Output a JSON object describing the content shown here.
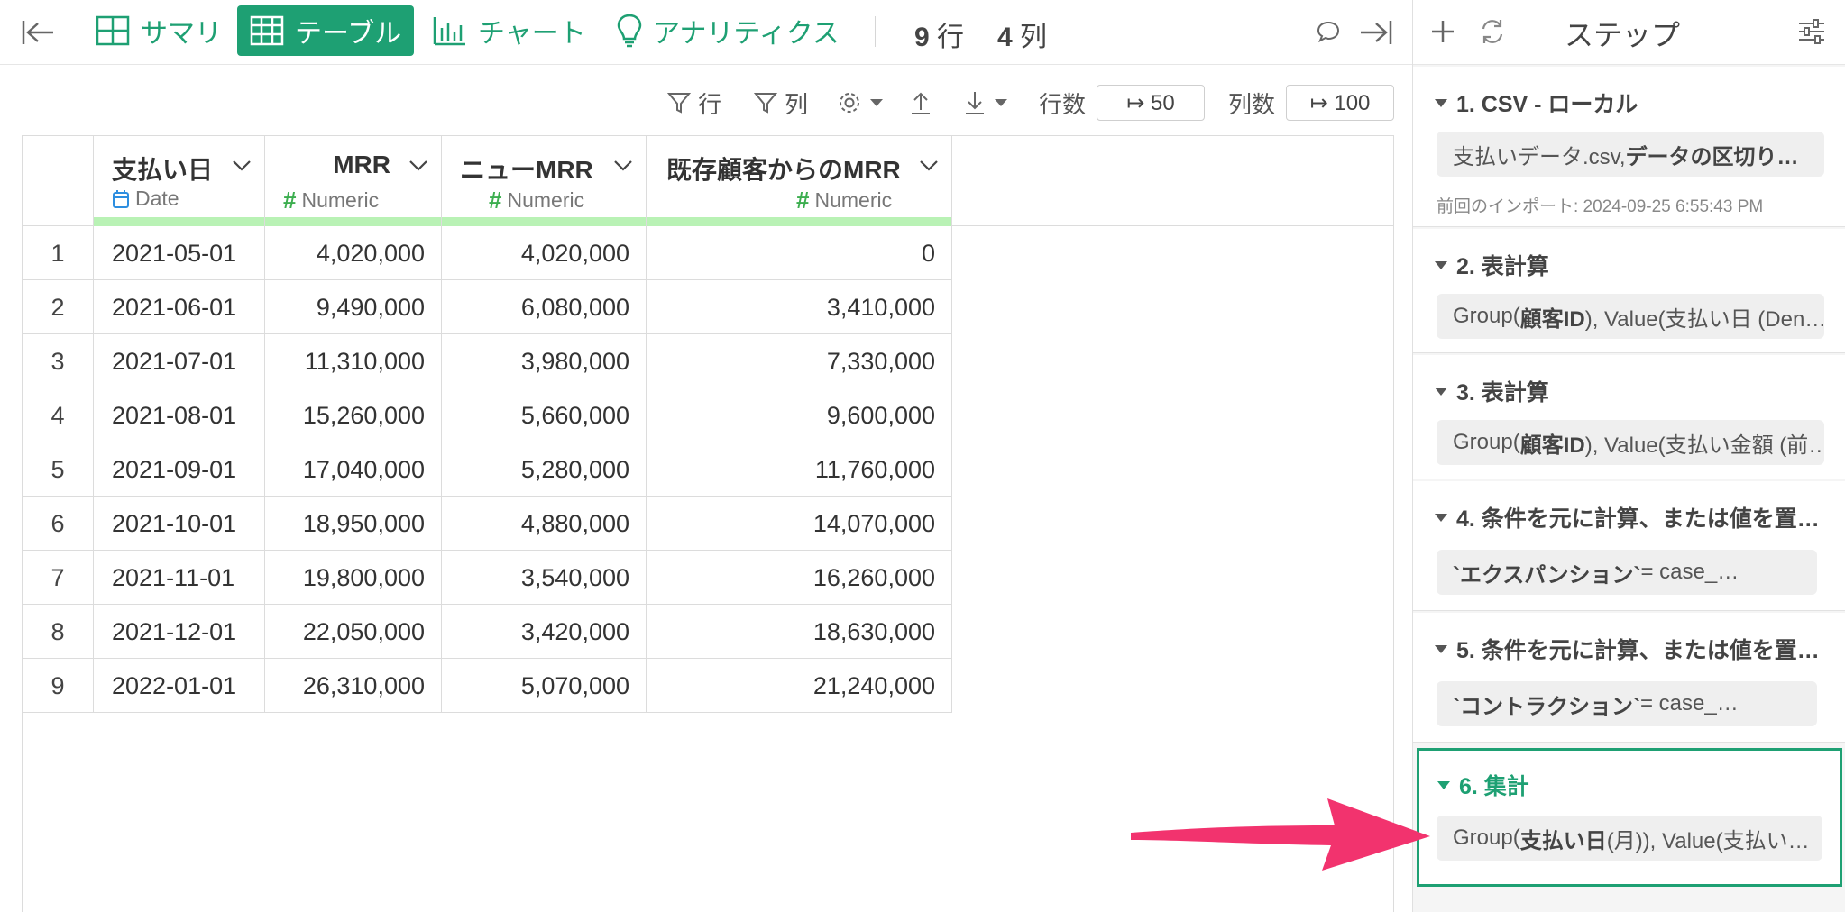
{
  "toolbar": {
    "tabs": [
      {
        "label": "サマリ",
        "icon": "summary-grid-icon",
        "active": false
      },
      {
        "label": "テーブル",
        "icon": "table-icon",
        "active": true
      },
      {
        "label": "チャート",
        "icon": "bar-chart-icon",
        "active": false
      },
      {
        "label": "アナリティクス",
        "icon": "lightbulb-icon",
        "active": false
      }
    ],
    "rows_count": "9",
    "rows_unit": "行",
    "cols_count": "4",
    "cols_unit": "列"
  },
  "subtoolbar": {
    "filter_rows": "行",
    "filter_cols": "列",
    "rows_label": "行数",
    "rows_value": "↦ 50",
    "cols_label": "列数",
    "cols_value": "↦ 100"
  },
  "table": {
    "columns": [
      {
        "name": "支払い日",
        "type": "Date"
      },
      {
        "name": "MRR",
        "type": "Numeric"
      },
      {
        "name": "ニューMRR",
        "type": "Numeric"
      },
      {
        "name": "既存顧客からのMRR",
        "type": "Numeric"
      }
    ],
    "rows": [
      [
        "1",
        "2021-05-01",
        "4,020,000",
        "4,020,000",
        "0"
      ],
      [
        "2",
        "2021-06-01",
        "9,490,000",
        "6,080,000",
        "3,410,000"
      ],
      [
        "3",
        "2021-07-01",
        "11,310,000",
        "3,980,000",
        "7,330,000"
      ],
      [
        "4",
        "2021-08-01",
        "15,260,000",
        "5,660,000",
        "9,600,000"
      ],
      [
        "5",
        "2021-09-01",
        "17,040,000",
        "5,280,000",
        "11,760,000"
      ],
      [
        "6",
        "2021-10-01",
        "18,950,000",
        "4,880,000",
        "14,070,000"
      ],
      [
        "7",
        "2021-11-01",
        "19,800,000",
        "3,540,000",
        "16,260,000"
      ],
      [
        "8",
        "2021-12-01",
        "22,050,000",
        "3,420,000",
        "18,630,000"
      ],
      [
        "9",
        "2022-01-01",
        "26,310,000",
        "5,070,000",
        "21,240,000"
      ]
    ]
  },
  "panel": {
    "title": "ステップ",
    "steps": [
      {
        "title": "1. CSV - ローカル",
        "detail_pre": "支払いデータ.csv, ",
        "detail_bold": "データの区切り…",
        "detail_post": "",
        "sub": "前回のインポート: 2024-09-25 6:55:43 PM"
      },
      {
        "title": "2. 表計算",
        "detail_pre": "Group(",
        "detail_bold": "顧客ID",
        "detail_post": "), Value(支払い日 (Den…"
      },
      {
        "title": "3. 表計算",
        "detail_pre": "Group(",
        "detail_bold": "顧客ID",
        "detail_post": "), Value(支払い金額 (前…"
      },
      {
        "title": "4. 条件を元に計算、または値を置…",
        "detail_pre": "",
        "detail_bold": "`エクスパンション`",
        "detail_post": " = case_…"
      },
      {
        "title": "5. 条件を元に計算、または値を置…",
        "detail_pre": "",
        "detail_bold": "`コントラクション`",
        "detail_post": " = case_…"
      },
      {
        "title": "6. 集計",
        "detail_pre": "Group(",
        "detail_bold": "支払い日",
        "detail_post": " (月)), Value(支払い…",
        "active": true
      }
    ]
  },
  "colors": {
    "accent": "#1ea073",
    "arrow": "#f2336e",
    "type_bar": "#b9f2b5"
  }
}
